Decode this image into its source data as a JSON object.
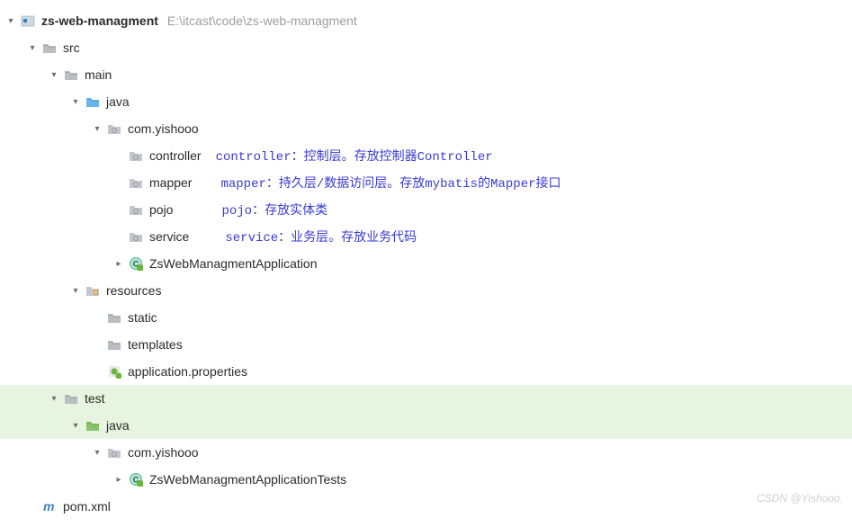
{
  "root": {
    "name": "zs-web-managment",
    "path": "E:\\itcast\\code\\zs-web-managment"
  },
  "tree": {
    "src": "src",
    "main": "main",
    "java": "java",
    "comYishooo": "com.yishooo",
    "controller": "controller",
    "mapper": "mapper",
    "pojo": "pojo",
    "service": "service",
    "app": "ZsWebManagmentApplication",
    "resources": "resources",
    "static": "static",
    "templates": "templates",
    "appProps": "application.properties",
    "test": "test",
    "testJava": "java",
    "testComYishooo": "com.yishooo",
    "appTests": "ZsWebManagmentApplicationTests",
    "pom": "pom.xml"
  },
  "annotations": {
    "controller": "controller：控制层。存放控制器Controller",
    "mapper": "mapper：持久层/数据访问层。存放mybatis的Mapper接口",
    "pojo": "pojo：存放实体类",
    "service": "service：业务层。存放业务代码"
  },
  "watermark": "CSDN @Yishooo."
}
